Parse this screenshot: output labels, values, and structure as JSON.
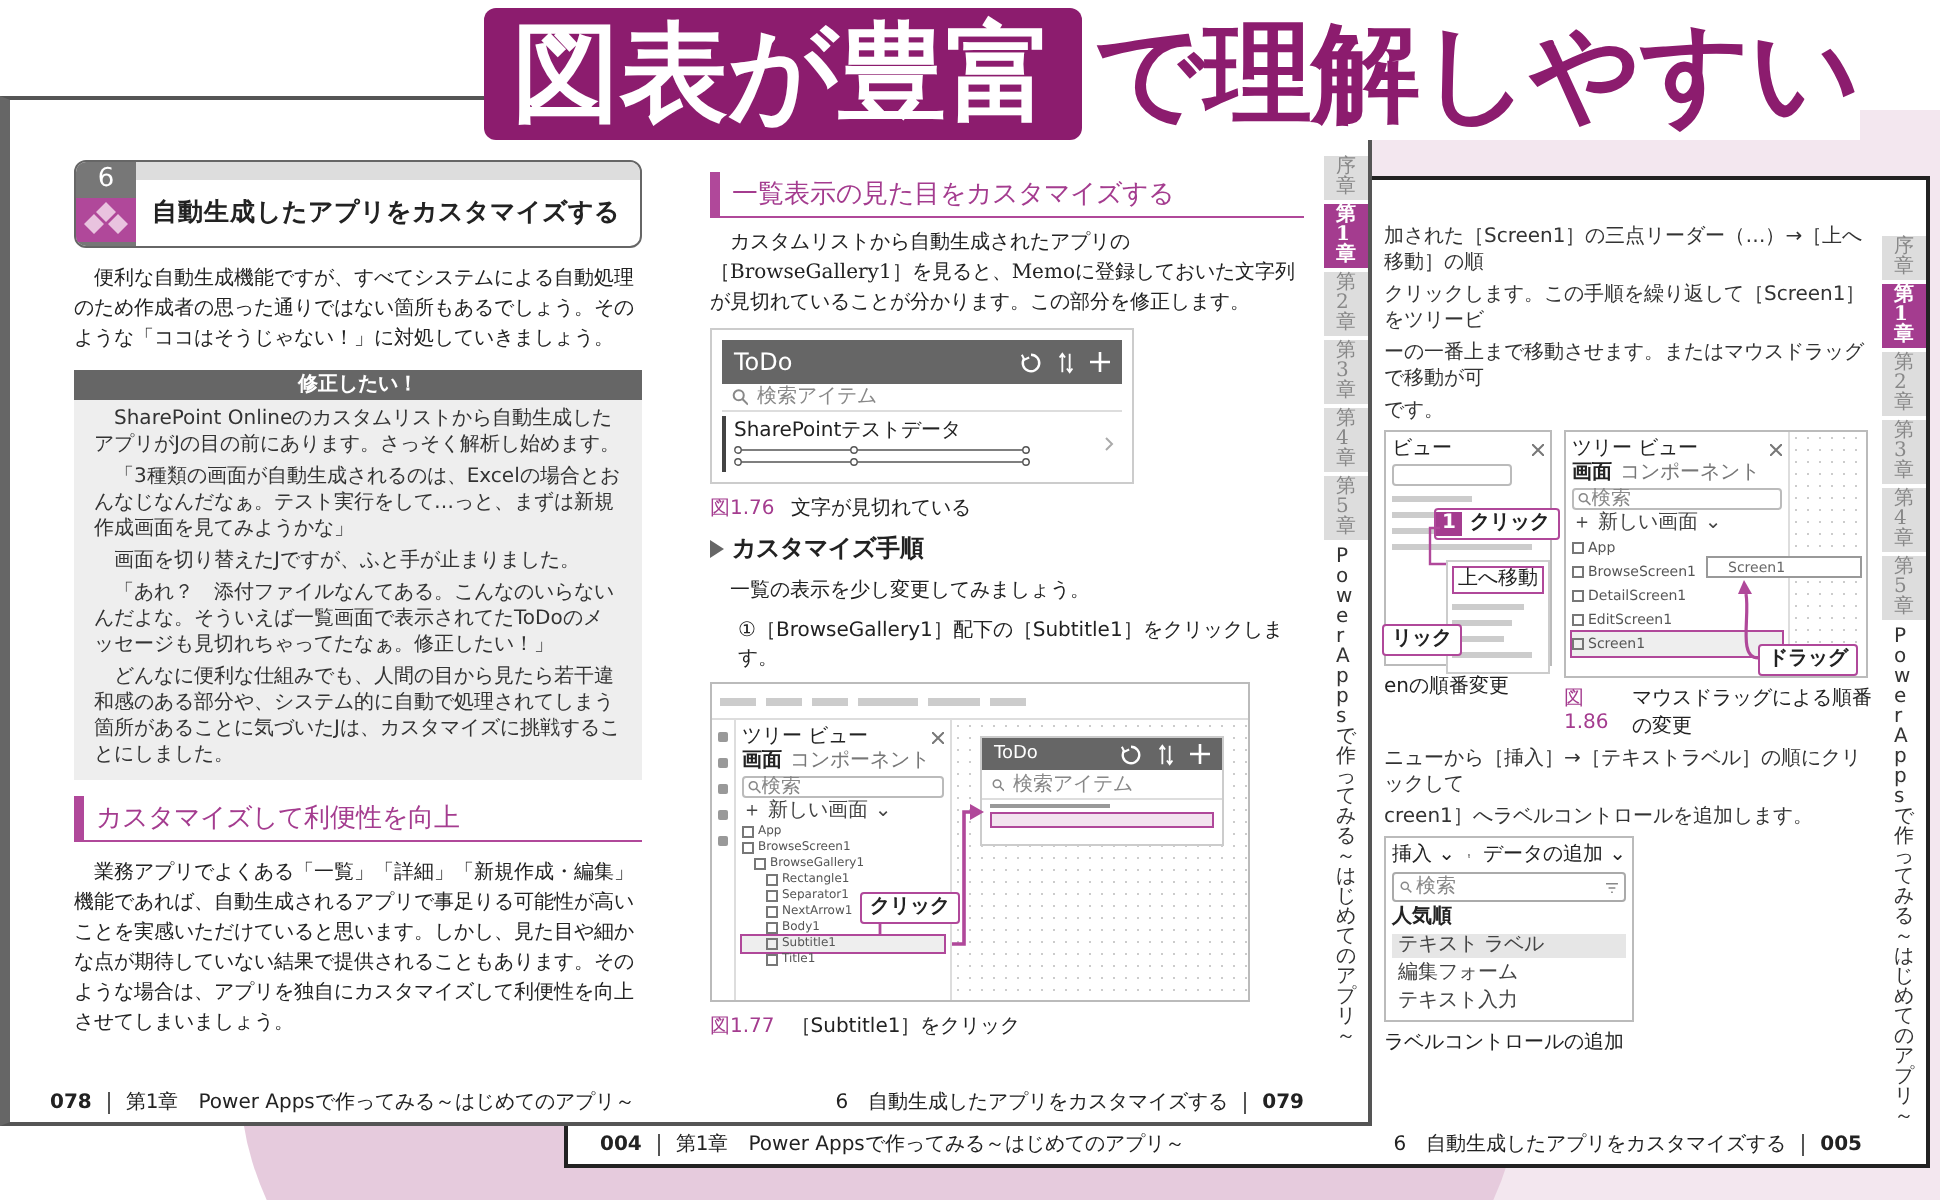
{
  "banner": {
    "highlight": "図表が豊富",
    "text": "で理解しやすい"
  },
  "front_spread": {
    "left_page": {
      "section_number": "6",
      "section_title": "自動生成したアプリをカスタマイズする",
      "intro": "便利な自動生成機能ですが、すべてシステムによる自動処理のため作成者の思った通りではない箇所もあるでしょう。そのような「ココはそうじゃない！」に対処していきましょう。",
      "column_box": {
        "title": "修正したい！",
        "paragraphs": [
          "SharePoint Onlineのカスタムリストから自動生成したアプリがJの目の前にあります。さっそく解析し始めます。",
          "「3種類の画面が自動生成されるのは、Excelの場合とおんなじなんだなぁ。テスト実行をして…っと、まずは新規作成画面を見てみようかな」",
          "画面を切り替えたJですが、ふと手が止まりました。",
          "「あれ？　添付ファイルなんてある。こんなのいらないんだよな。そういえば一覧画面で表示されてたToDoのメッセージも見切れちゃってたなぁ。修正したい！」",
          "どんなに便利な仕組みでも、人間の目から見たら若干違和感のある部分や、システム的に自動で処理されてしまう箇所があることに気づいたJは、カスタマイズに挑戦することにしました。"
        ]
      },
      "heading": "カスタマイズして利便性を向上",
      "body": "業務アプリでよくある「一覧」「詳細」「新規作成・編集」機能であれば、自動生成されるアプリで事足りる可能性が高いことを実感いただけていると思います。しかし、見た目や細かな点が期待していない結果で提供されることもあります。そのような場合は、アプリを独自にカスタマイズして利便性を向上させてしまいましょう。",
      "footer": {
        "page": "078",
        "running_head": "第1章　Power Appsで作ってみる～はじめてのアプリ～"
      }
    },
    "right_page": {
      "heading": "一覧表示の見た目をカスタマイズする",
      "body": "カスタムリストから自動生成されたアプリの［BrowseGallery1］を見ると、Memoに登録しておいた文字列が見切れていることが分かります。この部分を修正します。",
      "figure_1": {
        "app_title": "ToDo",
        "search_placeholder": "検索アイテム",
        "item_title": "SharePointテストデータ",
        "number": "図1.76",
        "caption": "文字が見切れている"
      },
      "procedure_heading": "カスタマイズ手順",
      "procedure_intro": "一覧の表示を少し変更してみましょう。",
      "step": "①［BrowseGallery1］配下の［Subtitle1］をクリックします。",
      "figure_2": {
        "panel_title": "ツリー ビュー",
        "tabs": [
          {
            "label": "画面",
            "selected": true
          },
          {
            "label": "コンポーネント",
            "selected": false
          }
        ],
        "search_placeholder": "検索",
        "new_screen": "＋ 新しい画面 ⌄",
        "tree": [
          {
            "label": "App",
            "selected": false
          },
          {
            "label": "BrowseScreen1",
            "selected": false,
            "children": [
              {
                "label": "BrowseGallery1",
                "selected": false,
                "children": [
                  {
                    "label": "Rectangle1",
                    "selected": false
                  },
                  {
                    "label": "Separator1",
                    "selected": false
                  },
                  {
                    "label": "NextArrow1",
                    "selected": false
                  },
                  {
                    "label": "Body1",
                    "selected": false
                  },
                  {
                    "label": "Subtitle1",
                    "selected": true
                  },
                  {
                    "label": "Title1",
                    "selected": false
                  }
                ]
              }
            ]
          }
        ],
        "callout": "クリック",
        "app_title": "ToDo",
        "app_search_placeholder": "検索アイテム",
        "number": "図1.77",
        "caption": "［Subtitle1］をクリック"
      },
      "footer": {
        "running_head": "6　自動生成したアプリをカスタマイズする",
        "page": "079"
      }
    },
    "chapter_tabs": [
      {
        "label": "序章",
        "selected": false
      },
      {
        "label": "第1章",
        "selected": true
      },
      {
        "label": "第2章",
        "selected": false
      },
      {
        "label": "第3章",
        "selected": false
      },
      {
        "label": "第4章",
        "selected": false
      },
      {
        "label": "第5章",
        "selected": false
      }
    ],
    "side_title": "Power Appsで作ってみる～はじめてのアプリ～"
  },
  "back_spread": {
    "paragraph_lines": [
      "加された［Screen1］の三点リーダー（…）→［上へ移動］の順",
      "クリックします。この手順を繰り返して［Screen1］をツリービ",
      "ーの一番上まで移動させます。またはマウスドラッグで移動が可",
      "です。"
    ],
    "figure_a": {
      "panel_title": "ビュー",
      "menu_item": "上へ移動",
      "callout_1_number": "1",
      "callout_1": "クリック",
      "callout_2": "リック",
      "caption": "enの順番変更"
    },
    "figure_b": {
      "panel_title": "ツリー ビュー",
      "tabs": [
        {
          "label": "画面",
          "selected": true
        },
        {
          "label": "コンポーネント",
          "selected": false
        }
      ],
      "search_placeholder": "検索",
      "new_screen": "＋ 新しい画面 ⌄",
      "items": [
        {
          "label": "App",
          "selected": false
        },
        {
          "label": "BrowseScreen1",
          "selected": false
        },
        {
          "label": "DetailScreen1",
          "selected": false
        },
        {
          "label": "EditScreen1",
          "selected": false
        },
        {
          "label": "Screen1",
          "selected": true
        }
      ],
      "drag_ghost": "Screen1",
      "callout": "ドラッグ",
      "number": "図1.86",
      "caption": "マウスドラッグによる順番の変更"
    },
    "paragraph_lines_2": [
      "ニューから［挿入］→［テキストラベル］の順にクリックして",
      "creen1］へラベルコントロールを追加します。"
    ],
    "figure_c": {
      "insert_menu": "挿入 ⌄",
      "add_data_menu": "データの追加 ⌄",
      "search_placeholder": "検索",
      "group_label": "人気順",
      "items": [
        {
          "label": "テキスト ラベル",
          "selected": true
        },
        {
          "label": "編集フォーム",
          "selected": false
        },
        {
          "label": "テキスト入力",
          "selected": false
        }
      ],
      "caption": "ラベルコントロールの追加"
    },
    "chapter_tabs": [
      {
        "label": "序章",
        "selected": false
      },
      {
        "label": "第1章",
        "selected": true
      },
      {
        "label": "第2章",
        "selected": false
      },
      {
        "label": "第3章",
        "selected": false
      },
      {
        "label": "第4章",
        "selected": false
      },
      {
        "label": "第5章",
        "selected": false
      }
    ],
    "side_title": "Power Appsで作ってみる～はじめてのアプリ～",
    "footer_left": {
      "page": "004",
      "running_head": "第1章　Power Appsで作ってみる～はじめてのアプリ～"
    },
    "footer_right": {
      "running_head": "6　自動生成したアプリをカスタマイズする",
      "page": "005"
    }
  }
}
